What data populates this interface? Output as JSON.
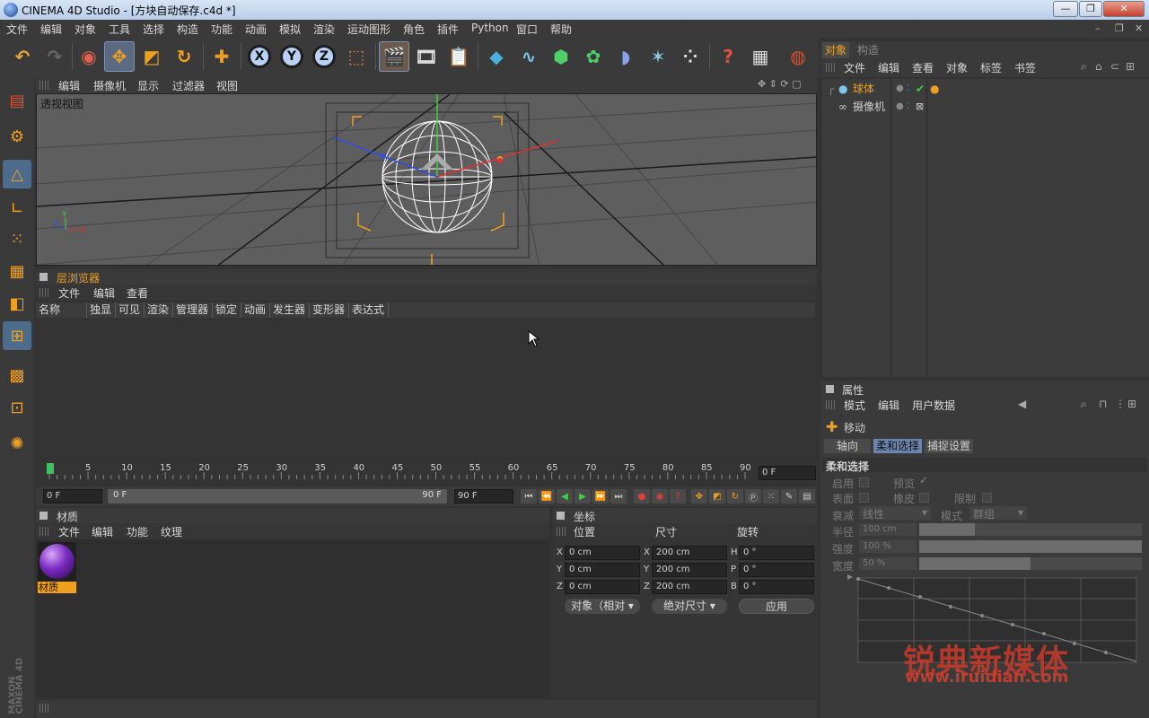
{
  "window": {
    "title": "CINEMA 4D Studio - [方块自动保存.c4d *]",
    "minimize": "—",
    "maximize": "❐",
    "close": "✕"
  },
  "menubar": {
    "items": [
      "文件",
      "编辑",
      "对象",
      "工具",
      "选择",
      "构造",
      "功能",
      "动画",
      "模拟",
      "渲染",
      "运动图形",
      "角色",
      "插件",
      "Python",
      "窗口",
      "帮助"
    ]
  },
  "viewport": {
    "menu": [
      "编辑",
      "摄像机",
      "显示",
      "过滤器",
      "视图"
    ],
    "label": "透视视图",
    "axis_labels": [
      "Y",
      "Z",
      "X"
    ]
  },
  "layer_browser": {
    "title": "层浏览器",
    "menu": [
      "文件",
      "编辑",
      "查看"
    ],
    "columns": [
      "名称",
      "独显",
      "可见",
      "渲染",
      "管理器",
      "锁定",
      "动画",
      "发生器",
      "变形器",
      "表达式"
    ]
  },
  "timeline": {
    "ticks": [
      "0",
      "5",
      "10",
      "15",
      "20",
      "25",
      "30",
      "35",
      "40",
      "45",
      "50",
      "55",
      "60",
      "65",
      "70",
      "75",
      "80",
      "85",
      "90"
    ],
    "current_frame": "0 F",
    "start_field": "0 F",
    "range_start": "0 F",
    "range_end": "90 F",
    "end_field": "90 F"
  },
  "materials": {
    "title": "材质",
    "menu": [
      "文件",
      "编辑",
      "功能",
      "纹理"
    ],
    "items": [
      {
        "name": "材质"
      }
    ]
  },
  "coordinates": {
    "title": "坐标",
    "headers": {
      "position": "位置",
      "size": "尺寸",
      "rotation": "旋转"
    },
    "rows": [
      {
        "axis": "X",
        "pos": "0 cm",
        "size_axis": "X",
        "size": "200 cm",
        "rot_axis": "H",
        "rot": "0 °"
      },
      {
        "axis": "Y",
        "pos": "0 cm",
        "size_axis": "Y",
        "size": "200 cm",
        "rot_axis": "P",
        "rot": "0 °"
      },
      {
        "axis": "Z",
        "pos": "0 cm",
        "size_axis": "Z",
        "size": "200 cm",
        "rot_axis": "B",
        "rot": "0 °"
      }
    ],
    "mode_dropdown": "对象（相对",
    "size_dropdown": "绝对尺寸",
    "apply_button": "应用"
  },
  "object_manager": {
    "tabs": [
      "对象",
      "构造"
    ],
    "menu": [
      "文件",
      "编辑",
      "查看",
      "对象",
      "标签",
      "书签"
    ],
    "objects": [
      {
        "name": "球体",
        "color": "#f0a020"
      },
      {
        "name": "摄像机",
        "color": "#d0d0d0"
      }
    ]
  },
  "attributes": {
    "title": "属性",
    "menu": [
      "模式",
      "编辑",
      "用户数据"
    ],
    "tool_name": "移动",
    "tabs": [
      "轴向",
      "柔和选择",
      "捕捉设置"
    ],
    "section": "柔和选择",
    "labels": {
      "enable": "启用",
      "preview": "预览",
      "surface": "表面",
      "rubber": "橡皮",
      "limit": "限制",
      "falloff": "衰减",
      "falloff_value": "线性",
      "mode": "模式",
      "mode_value": "群组",
      "radius": "半径",
      "radius_value": "100 cm",
      "strength": "强度",
      "strength_value": "100 %",
      "width": "宽度",
      "width_value": "50 %"
    },
    "radius_fill": 0.25,
    "strength_fill": 1.0,
    "width_fill": 0.5
  },
  "branding": {
    "maxon": "MAXON",
    "c4d": "CINEMA 4D"
  },
  "watermark": {
    "cn": "锐典新媒体",
    "url": "www.iruidian.com"
  }
}
